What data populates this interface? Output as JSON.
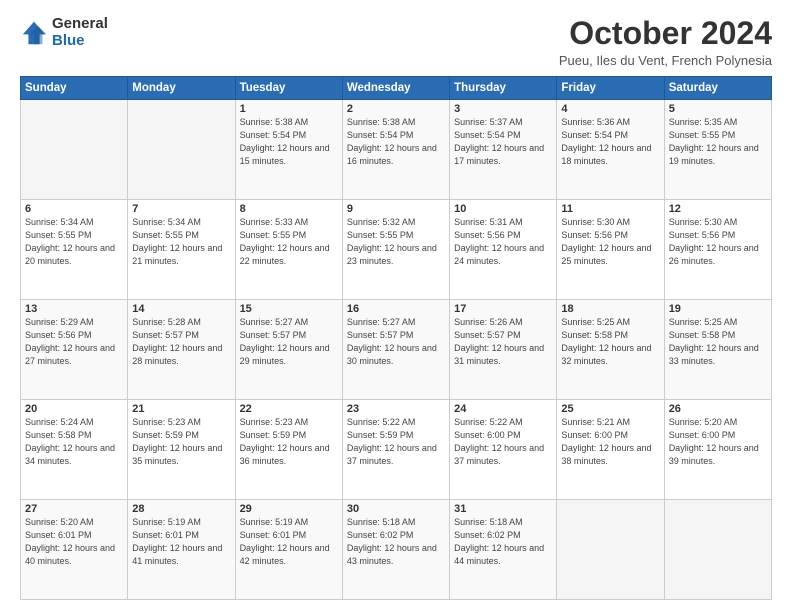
{
  "logo": {
    "general": "General",
    "blue": "Blue"
  },
  "header": {
    "title": "October 2024",
    "subtitle": "Pueu, Iles du Vent, French Polynesia"
  },
  "weekdays": [
    "Sunday",
    "Monday",
    "Tuesday",
    "Wednesday",
    "Thursday",
    "Friday",
    "Saturday"
  ],
  "weeks": [
    [
      {
        "day": "",
        "sunrise": "",
        "sunset": "",
        "daylight": ""
      },
      {
        "day": "",
        "sunrise": "",
        "sunset": "",
        "daylight": ""
      },
      {
        "day": "1",
        "sunrise": "Sunrise: 5:38 AM",
        "sunset": "Sunset: 5:54 PM",
        "daylight": "Daylight: 12 hours and 15 minutes."
      },
      {
        "day": "2",
        "sunrise": "Sunrise: 5:38 AM",
        "sunset": "Sunset: 5:54 PM",
        "daylight": "Daylight: 12 hours and 16 minutes."
      },
      {
        "day": "3",
        "sunrise": "Sunrise: 5:37 AM",
        "sunset": "Sunset: 5:54 PM",
        "daylight": "Daylight: 12 hours and 17 minutes."
      },
      {
        "day": "4",
        "sunrise": "Sunrise: 5:36 AM",
        "sunset": "Sunset: 5:54 PM",
        "daylight": "Daylight: 12 hours and 18 minutes."
      },
      {
        "day": "5",
        "sunrise": "Sunrise: 5:35 AM",
        "sunset": "Sunset: 5:55 PM",
        "daylight": "Daylight: 12 hours and 19 minutes."
      }
    ],
    [
      {
        "day": "6",
        "sunrise": "Sunrise: 5:34 AM",
        "sunset": "Sunset: 5:55 PM",
        "daylight": "Daylight: 12 hours and 20 minutes."
      },
      {
        "day": "7",
        "sunrise": "Sunrise: 5:34 AM",
        "sunset": "Sunset: 5:55 PM",
        "daylight": "Daylight: 12 hours and 21 minutes."
      },
      {
        "day": "8",
        "sunrise": "Sunrise: 5:33 AM",
        "sunset": "Sunset: 5:55 PM",
        "daylight": "Daylight: 12 hours and 22 minutes."
      },
      {
        "day": "9",
        "sunrise": "Sunrise: 5:32 AM",
        "sunset": "Sunset: 5:55 PM",
        "daylight": "Daylight: 12 hours and 23 minutes."
      },
      {
        "day": "10",
        "sunrise": "Sunrise: 5:31 AM",
        "sunset": "Sunset: 5:56 PM",
        "daylight": "Daylight: 12 hours and 24 minutes."
      },
      {
        "day": "11",
        "sunrise": "Sunrise: 5:30 AM",
        "sunset": "Sunset: 5:56 PM",
        "daylight": "Daylight: 12 hours and 25 minutes."
      },
      {
        "day": "12",
        "sunrise": "Sunrise: 5:30 AM",
        "sunset": "Sunset: 5:56 PM",
        "daylight": "Daylight: 12 hours and 26 minutes."
      }
    ],
    [
      {
        "day": "13",
        "sunrise": "Sunrise: 5:29 AM",
        "sunset": "Sunset: 5:56 PM",
        "daylight": "Daylight: 12 hours and 27 minutes."
      },
      {
        "day": "14",
        "sunrise": "Sunrise: 5:28 AM",
        "sunset": "Sunset: 5:57 PM",
        "daylight": "Daylight: 12 hours and 28 minutes."
      },
      {
        "day": "15",
        "sunrise": "Sunrise: 5:27 AM",
        "sunset": "Sunset: 5:57 PM",
        "daylight": "Daylight: 12 hours and 29 minutes."
      },
      {
        "day": "16",
        "sunrise": "Sunrise: 5:27 AM",
        "sunset": "Sunset: 5:57 PM",
        "daylight": "Daylight: 12 hours and 30 minutes."
      },
      {
        "day": "17",
        "sunrise": "Sunrise: 5:26 AM",
        "sunset": "Sunset: 5:57 PM",
        "daylight": "Daylight: 12 hours and 31 minutes."
      },
      {
        "day": "18",
        "sunrise": "Sunrise: 5:25 AM",
        "sunset": "Sunset: 5:58 PM",
        "daylight": "Daylight: 12 hours and 32 minutes."
      },
      {
        "day": "19",
        "sunrise": "Sunrise: 5:25 AM",
        "sunset": "Sunset: 5:58 PM",
        "daylight": "Daylight: 12 hours and 33 minutes."
      }
    ],
    [
      {
        "day": "20",
        "sunrise": "Sunrise: 5:24 AM",
        "sunset": "Sunset: 5:58 PM",
        "daylight": "Daylight: 12 hours and 34 minutes."
      },
      {
        "day": "21",
        "sunrise": "Sunrise: 5:23 AM",
        "sunset": "Sunset: 5:59 PM",
        "daylight": "Daylight: 12 hours and 35 minutes."
      },
      {
        "day": "22",
        "sunrise": "Sunrise: 5:23 AM",
        "sunset": "Sunset: 5:59 PM",
        "daylight": "Daylight: 12 hours and 36 minutes."
      },
      {
        "day": "23",
        "sunrise": "Sunrise: 5:22 AM",
        "sunset": "Sunset: 5:59 PM",
        "daylight": "Daylight: 12 hours and 37 minutes."
      },
      {
        "day": "24",
        "sunrise": "Sunrise: 5:22 AM",
        "sunset": "Sunset: 6:00 PM",
        "daylight": "Daylight: 12 hours and 37 minutes."
      },
      {
        "day": "25",
        "sunrise": "Sunrise: 5:21 AM",
        "sunset": "Sunset: 6:00 PM",
        "daylight": "Daylight: 12 hours and 38 minutes."
      },
      {
        "day": "26",
        "sunrise": "Sunrise: 5:20 AM",
        "sunset": "Sunset: 6:00 PM",
        "daylight": "Daylight: 12 hours and 39 minutes."
      }
    ],
    [
      {
        "day": "27",
        "sunrise": "Sunrise: 5:20 AM",
        "sunset": "Sunset: 6:01 PM",
        "daylight": "Daylight: 12 hours and 40 minutes."
      },
      {
        "day": "28",
        "sunrise": "Sunrise: 5:19 AM",
        "sunset": "Sunset: 6:01 PM",
        "daylight": "Daylight: 12 hours and 41 minutes."
      },
      {
        "day": "29",
        "sunrise": "Sunrise: 5:19 AM",
        "sunset": "Sunset: 6:01 PM",
        "daylight": "Daylight: 12 hours and 42 minutes."
      },
      {
        "day": "30",
        "sunrise": "Sunrise: 5:18 AM",
        "sunset": "Sunset: 6:02 PM",
        "daylight": "Daylight: 12 hours and 43 minutes."
      },
      {
        "day": "31",
        "sunrise": "Sunrise: 5:18 AM",
        "sunset": "Sunset: 6:02 PM",
        "daylight": "Daylight: 12 hours and 44 minutes."
      },
      {
        "day": "",
        "sunrise": "",
        "sunset": "",
        "daylight": ""
      },
      {
        "day": "",
        "sunrise": "",
        "sunset": "",
        "daylight": ""
      }
    ]
  ]
}
